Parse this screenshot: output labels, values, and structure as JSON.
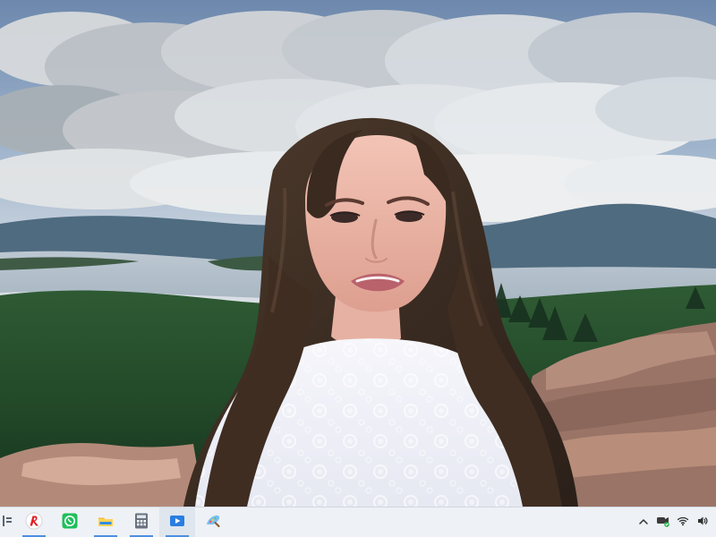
{
  "taskbar": {
    "left_items": [
      {
        "name": "partial-start-icon"
      },
      {
        "name": "yandex-icon"
      },
      {
        "name": "whatsapp-icon"
      },
      {
        "name": "file-explorer-icon"
      },
      {
        "name": "calculator-icon"
      },
      {
        "name": "media-player-icon",
        "active": true
      },
      {
        "name": "paint-icon"
      }
    ],
    "tray_items": [
      {
        "name": "chevron-up-icon"
      },
      {
        "name": "meet-now-icon"
      },
      {
        "name": "wifi-icon"
      },
      {
        "name": "volume-icon"
      }
    ]
  },
  "colors": {
    "taskbar_bg": "#eef1f5",
    "accent": "#4c8fe0"
  }
}
